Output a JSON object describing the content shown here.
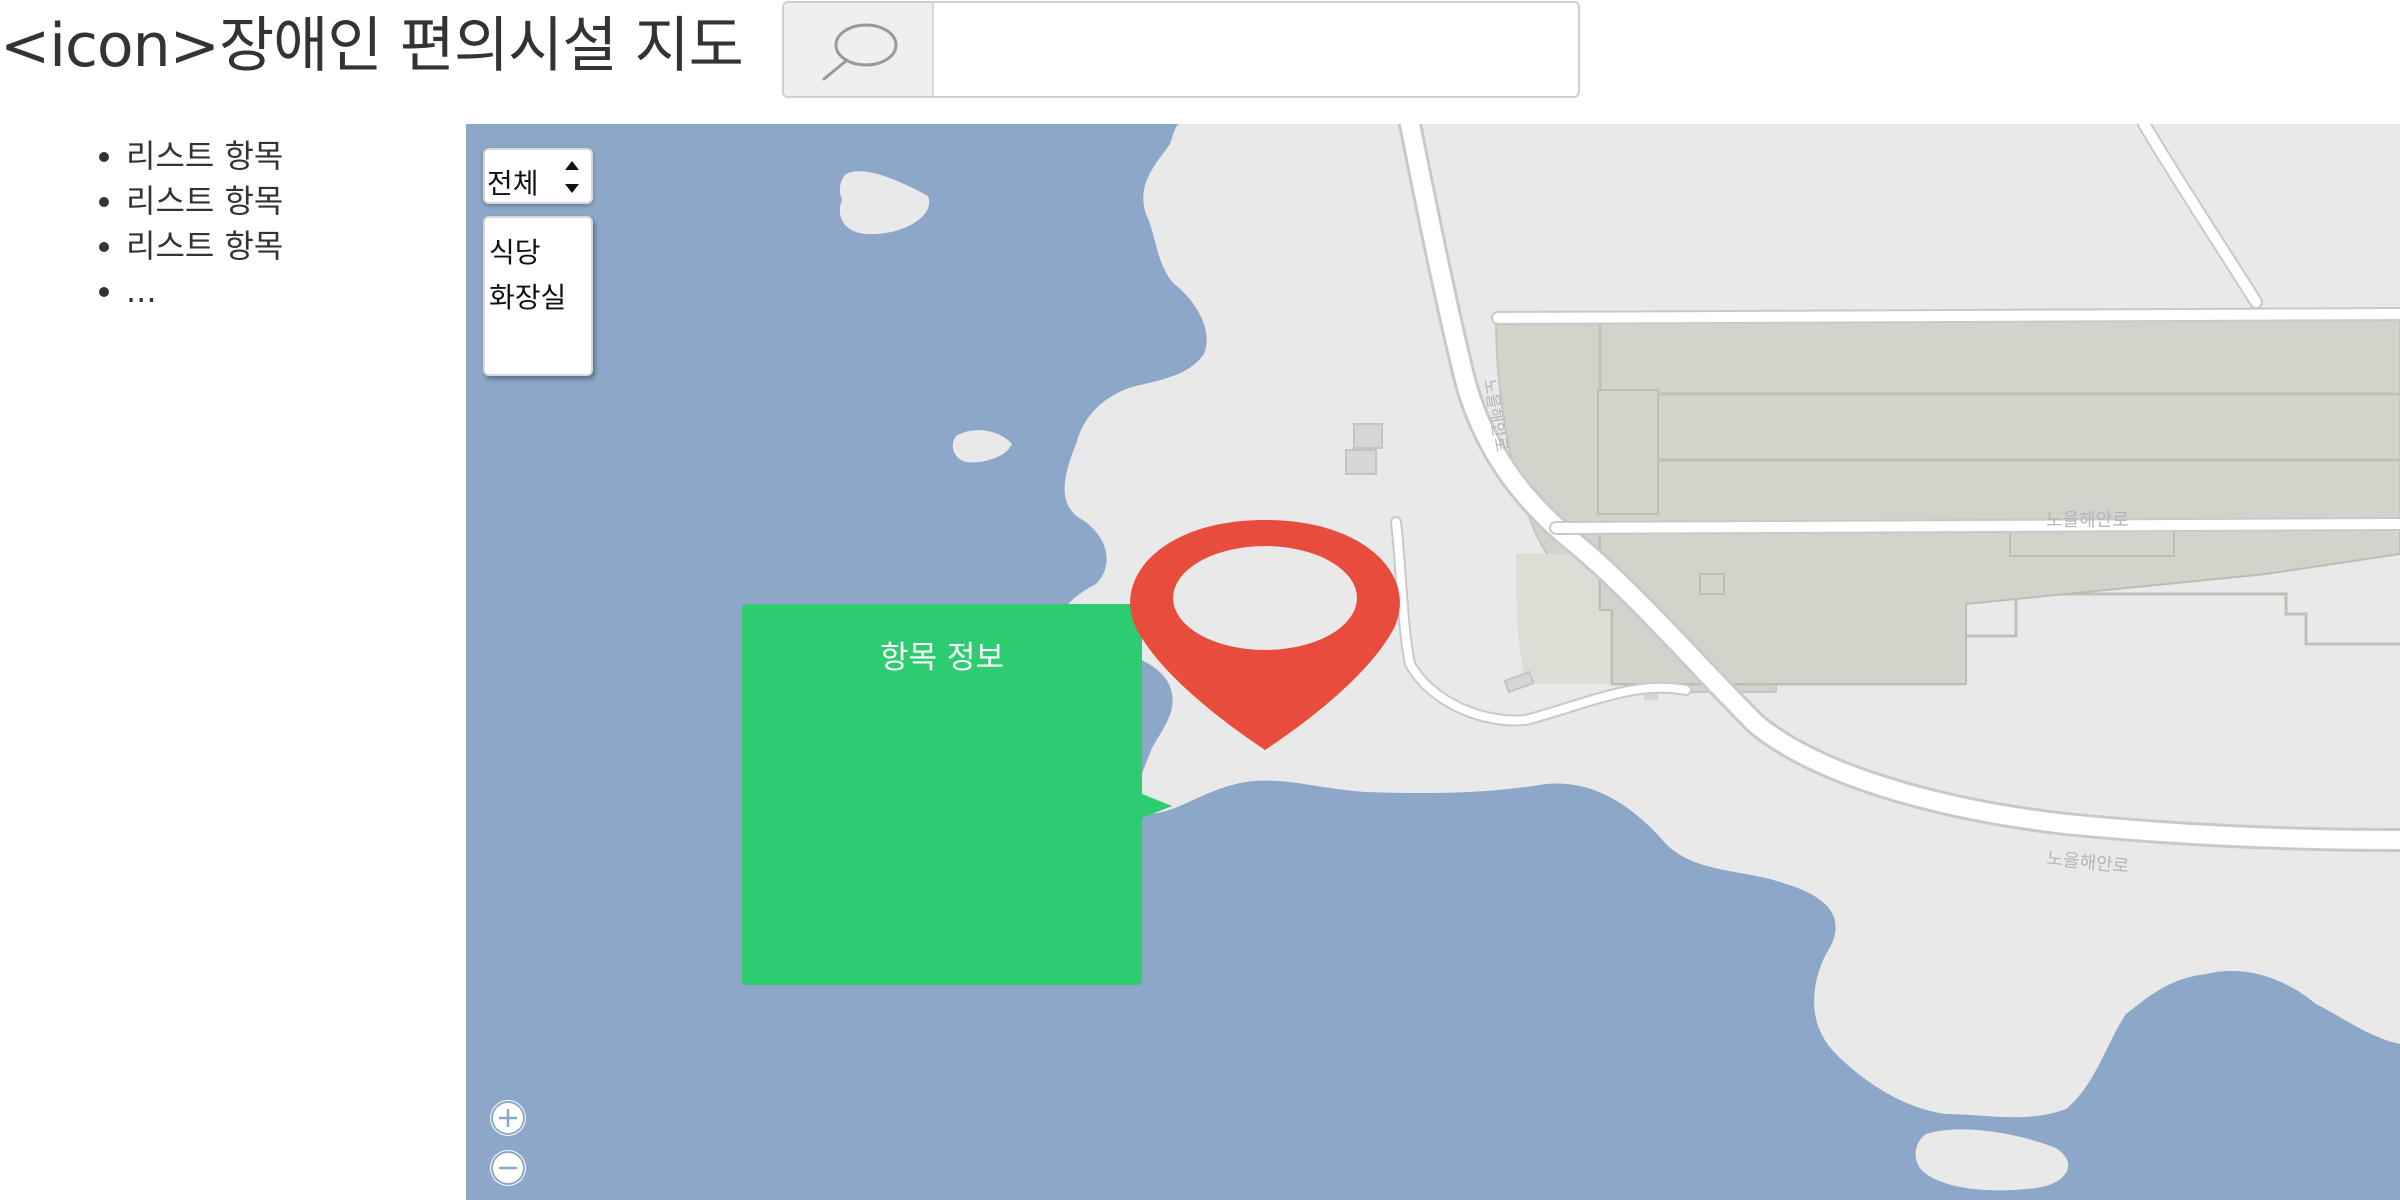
{
  "header": {
    "title": "<icon>장애인 편의시설 지도",
    "search": {
      "value": "",
      "placeholder": "",
      "button_icon": "search-icon"
    }
  },
  "sidebar": {
    "items": [
      {
        "label": "리스트 항목"
      },
      {
        "label": "리스트 항목"
      },
      {
        "label": "리스트 항목"
      },
      {
        "label": "..."
      }
    ]
  },
  "map": {
    "category_select": {
      "selected": "전체",
      "options": [
        "식당",
        "화장실"
      ]
    },
    "popup": {
      "title": "항목 정보"
    },
    "road_labels": [
      "노을해안로",
      "노을해안로",
      "노을해안로"
    ],
    "zoom": {
      "in_icon": "plus-icon",
      "out_icon": "minus-icon"
    },
    "colors": {
      "water": "#8da7c9",
      "land": "#e9e9e9",
      "park": "#d2d4cc",
      "marker": "#e74c3c",
      "popup": "#2ecc71"
    }
  }
}
